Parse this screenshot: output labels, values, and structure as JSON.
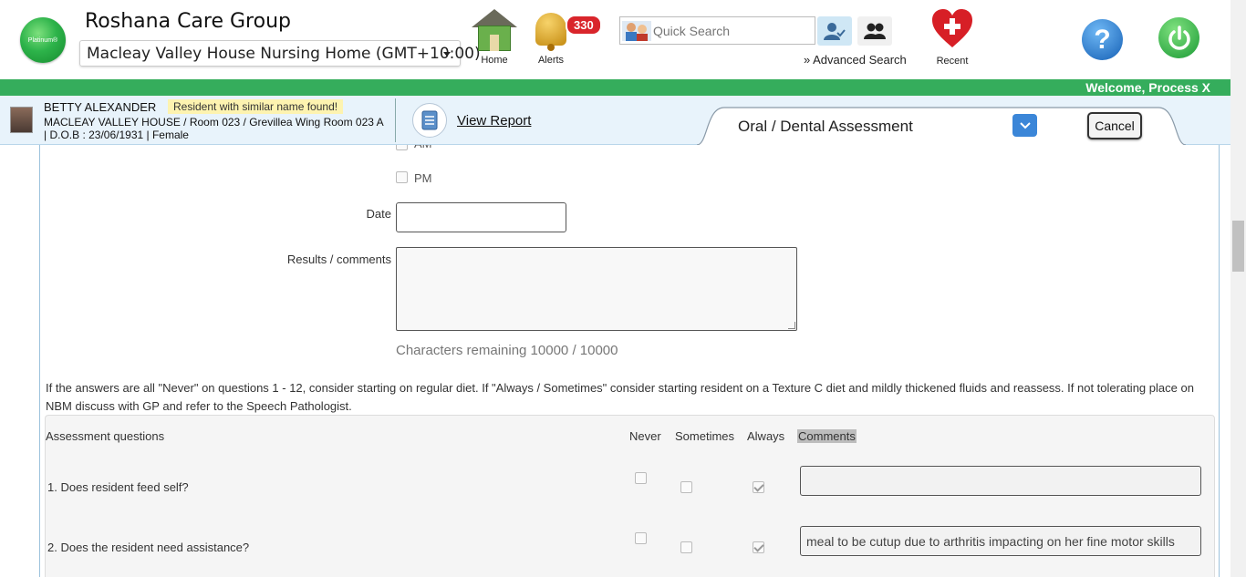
{
  "header": {
    "org_name": "Roshana Care Group",
    "logo_text": "Platinum®",
    "facility": "Macleay Valley House Nursing Home (GMT+10:00)",
    "nav": {
      "home_label": "Home",
      "alerts_label": "Alerts",
      "alerts_count": "330",
      "recent_label": "Recent"
    },
    "search": {
      "placeholder": "Quick Search",
      "advanced_label": "Advanced Search",
      "advanced_prefix": "»"
    },
    "help_glyph": "?"
  },
  "welcome": "Welcome, Process X",
  "resident": {
    "name": "BETTY ALEXANDER",
    "warning": "Resident with similar name found!",
    "location": "MACLEAY VALLEY HOUSE / Room 023 / Grevillea Wing Room 023 A",
    "dob": "| D.O.B : 23/06/1931 | Female",
    "view_report": "View Report"
  },
  "form": {
    "title": "Oral / Dental Assessment",
    "cancel_label": "Cancel"
  },
  "time_options": [
    {
      "label": "AM",
      "checked": false
    },
    {
      "label": "PM",
      "checked": false
    }
  ],
  "fields": {
    "date_label": "Date",
    "date_value": "",
    "results_label": "Results / comments",
    "results_value": "",
    "chars_remaining": "Characters remaining 10000 / 10000"
  },
  "instructions": "If the answers are all \"Never\" on questions 1 - 12, consider starting on regular diet. If \"Always / Sometimes\" consider starting resident on a Texture C diet and mildly thickened fluids and reassess. If not tolerating place on NBM discuss with GP and refer to the Speech Pathologist.",
  "assessment": {
    "headers": {
      "question": "Assessment questions",
      "never": "Never",
      "sometimes": "Sometimes",
      "always": "Always",
      "comments": "Comments"
    },
    "questions": [
      {
        "text": "1. Does resident feed self?",
        "answer": "Always",
        "comment": ""
      },
      {
        "text": "2. Does the resident need assistance?",
        "answer": "Always",
        "comment": "meal to be cutup due to arthritis impacting on her fine motor skills"
      }
    ]
  }
}
